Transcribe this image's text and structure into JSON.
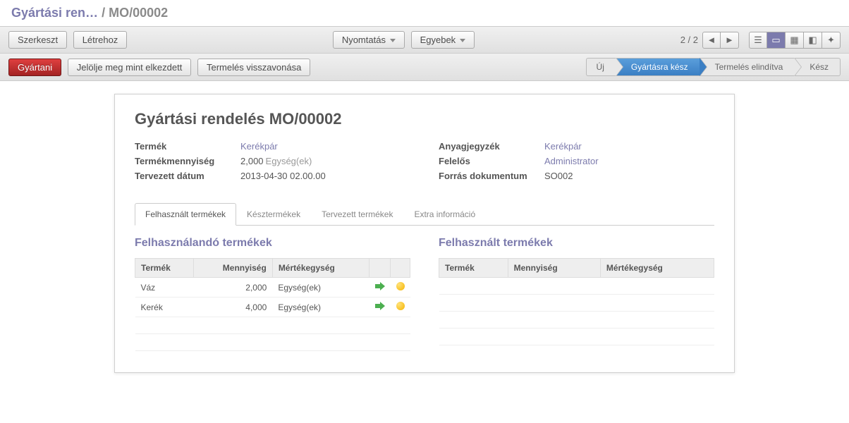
{
  "breadcrumb": {
    "parent": "Gyártási ren…",
    "current": "MO/00002"
  },
  "buttons": {
    "edit": "Szerkeszt",
    "create": "Létrehoz",
    "print": "Nyomtatás",
    "others": "Egyebek",
    "produce": "Gyártani",
    "mark_started": "Jelölje meg mint elkezdett",
    "cancel_prod": "Termelés visszavonása"
  },
  "pager": {
    "text": "2 / 2"
  },
  "status": {
    "steps": [
      "Új",
      "Gyártásra kész",
      "Termelés elindítva",
      "Kész"
    ],
    "active_index": 1
  },
  "title": "Gyártási rendelés MO/00002",
  "fields_left": {
    "product_label": "Termék",
    "product_value": "Kerékpár",
    "qty_label": "Termékmennyiség",
    "qty_value": "2,000",
    "qty_unit": "Egység(ek)",
    "date_label": "Tervezett dátum",
    "date_value": "2013-04-30 02.00.00"
  },
  "fields_right": {
    "bom_label": "Anyagjegyzék",
    "bom_value": "Kerékpár",
    "resp_label": "Felelős",
    "resp_value": "Administrator",
    "src_label": "Forrás dokumentum",
    "src_value": "SO002"
  },
  "tabs": [
    "Felhasznált termékek",
    "Késztermékek",
    "Tervezett termékek",
    "Extra információ"
  ],
  "active_tab": 0,
  "left_table": {
    "title": "Felhasználandó termékek",
    "cols": {
      "product": "Termék",
      "qty": "Mennyiség",
      "uom": "Mértékegység"
    },
    "rows": [
      {
        "product": "Váz",
        "qty": "2,000",
        "uom": "Egység(ek)"
      },
      {
        "product": "Kerék",
        "qty": "4,000",
        "uom": "Egység(ek)"
      }
    ]
  },
  "right_table": {
    "title": "Felhasznált termékek",
    "cols": {
      "product": "Termék",
      "qty": "Mennyiség",
      "uom": "Mértékegység"
    }
  }
}
